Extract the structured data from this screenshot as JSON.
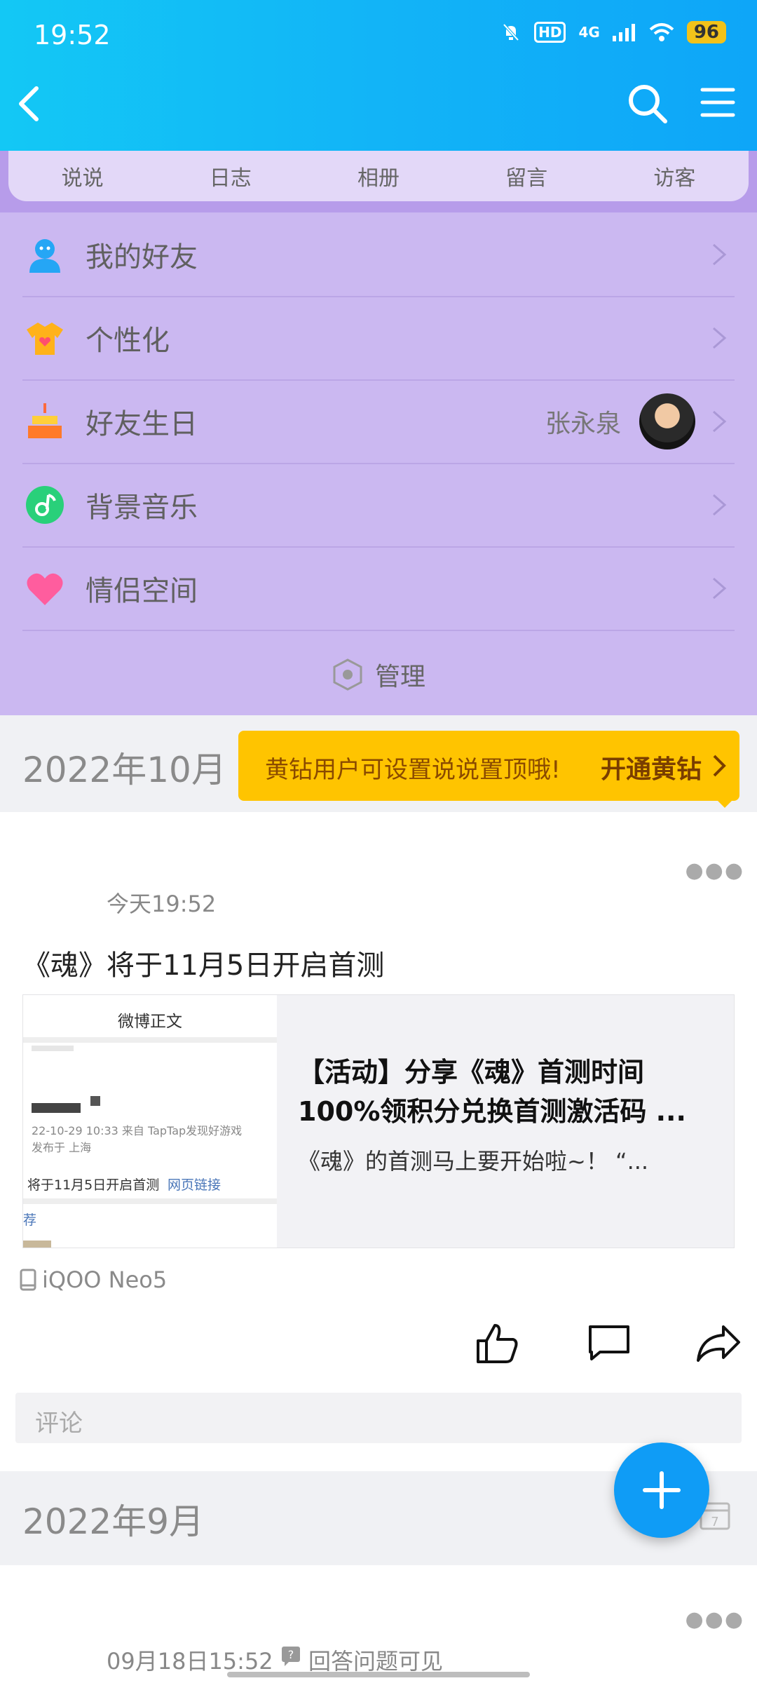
{
  "status_bar": {
    "time": "19:52",
    "network": "4G",
    "hd": "HD",
    "battery": "96"
  },
  "tabs": [
    "说说",
    "日志",
    "相册",
    "留言",
    "访客"
  ],
  "menu": {
    "items": [
      {
        "label": "我的好友",
        "icon": "friends-icon"
      },
      {
        "label": "个性化",
        "icon": "shirt-icon"
      },
      {
        "label": "好友生日",
        "icon": "cake-icon",
        "extra": "张永泉"
      },
      {
        "label": "背景音乐",
        "icon": "music-icon"
      },
      {
        "label": "情侣空间",
        "icon": "heart-icon"
      }
    ],
    "manage_label": "管理"
  },
  "month1": "2022年10月",
  "vip_banner": {
    "text": "黄钻用户可设置说说置顶哦!",
    "action": "开通黄钻"
  },
  "post": {
    "time": "今天19:52",
    "text": "《魂》将于11月5日开启首测",
    "card": {
      "thumb_title": "微博正文",
      "thumb_meta1": "22-10-29 10:33  来自 TapTap发现好游戏",
      "thumb_meta2": "发布于 上海",
      "thumb_body": "将于11月5日开启首测",
      "thumb_link": "网页链接",
      "thumb_rec": "荐",
      "title": "【活动】分享《魂》首测时间100%领积分兑换首测激活码 ...",
      "desc": "《魂》的首测马上要开始啦~！  “..."
    },
    "device": "iQOO Neo5",
    "comment_placeholder": "评论"
  },
  "month2": "2022年9月",
  "post2": {
    "time": "09月18日15:52",
    "visibility": "回答问题可见"
  },
  "colors": {
    "header": "#12b4f7",
    "panel": "#cbb8f1",
    "vip": "#ffc400",
    "fab": "#0f9cf6"
  }
}
